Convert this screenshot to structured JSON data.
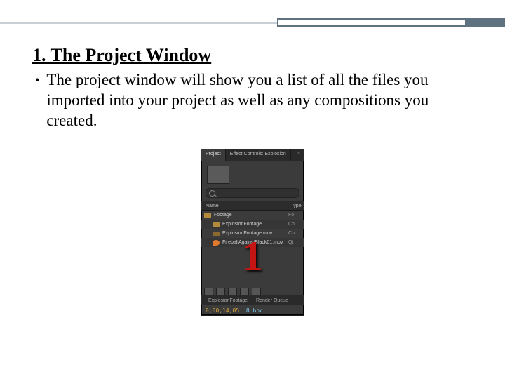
{
  "heading": "1. The Project Window",
  "bullet": "The project window will show you a list of all the files you imported into your project as well as any compositions you created.",
  "overlay_number": "1",
  "panel": {
    "tab_active": "Project",
    "tab_inactive": "Effect Controls: Explosion",
    "close": "×",
    "col_name": "Name",
    "col_type": "Type",
    "rows": [
      {
        "name": "Footage",
        "type": "Fo",
        "kind": "folder",
        "indent": false
      },
      {
        "name": "ExplosionFootage",
        "type": "Co",
        "kind": "comp",
        "indent": true
      },
      {
        "name": "ExplosionFootage.mov",
        "type": "Co",
        "kind": "bar",
        "indent": true
      },
      {
        "name": "FireballAgainstBlack01.mov",
        "type": "Qt",
        "kind": "fire",
        "indent": true
      }
    ],
    "footer_item1": "ExplosionFootage",
    "footer_item2": "Render Queue",
    "timecode": "0;00;14;05",
    "bpc": "8 bpc"
  }
}
